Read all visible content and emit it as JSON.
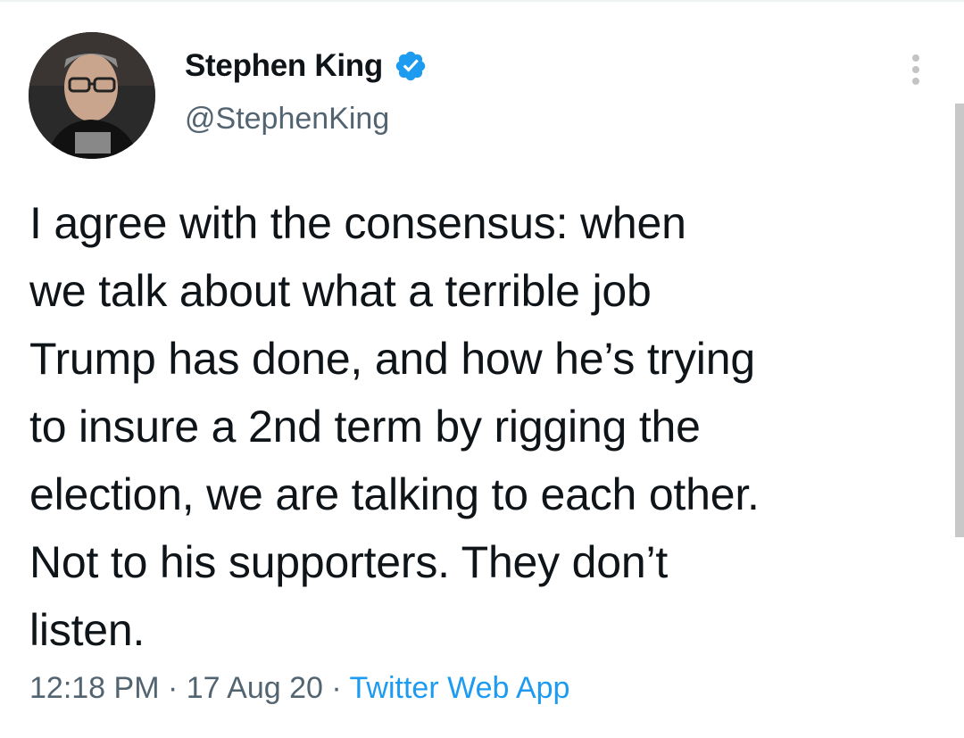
{
  "tweet": {
    "author": {
      "display_name": "Stephen King",
      "handle": "@StephenKing",
      "verified_icon": "verified-badge-icon",
      "avatar_icon": "avatar"
    },
    "text": "I agree with the consensus: when\nwe talk about what a terrible job\nTrump has done, and how he’s trying\nto insure a 2nd term by rigging the\nelection, we are talking to each other.\nNot to his supporters. They don’t\nlisten.",
    "time": "12:18 PM",
    "separator": " · ",
    "date": "17 Aug 20",
    "source": "Twitter Web App",
    "more_icon": "more-options-icon"
  },
  "colors": {
    "text_primary": "#0f1419",
    "text_secondary": "#536471",
    "link": "#1d9bf0",
    "verified": "#1d9bf0"
  }
}
